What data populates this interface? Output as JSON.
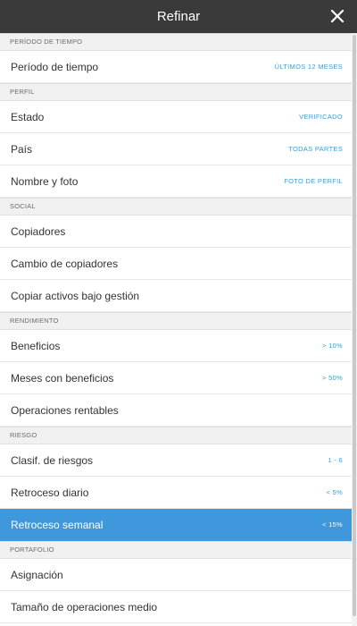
{
  "header": {
    "title": "Refinar"
  },
  "colors": {
    "accent": "#3b9cd6",
    "header_bg": "#3a3a3a",
    "selected_bg": "#3f98db"
  },
  "sections": [
    {
      "title": "PERÍODO DE TIEMPO",
      "rows": [
        {
          "label": "Período de tiempo",
          "value": "ÚLTIMOS 12 MESES"
        }
      ]
    },
    {
      "title": "PERFIL",
      "rows": [
        {
          "label": "Estado",
          "value": "VERIFICADO"
        },
        {
          "label": "País",
          "value": "TODAS PARTES"
        },
        {
          "label": "Nombre y foto",
          "value": "FOTO DE PERFIL"
        }
      ]
    },
    {
      "title": "SOCIAL",
      "rows": [
        {
          "label": "Copiadores",
          "value": ""
        },
        {
          "label": "Cambio de copiadores",
          "value": ""
        },
        {
          "label": "Copiar activos bajo gestión",
          "value": ""
        }
      ]
    },
    {
      "title": "RENDIMIENTO",
      "rows": [
        {
          "label": "Beneficios",
          "value": "> 10%"
        },
        {
          "label": "Meses con beneficios",
          "value": "> 50%"
        },
        {
          "label": "Operaciones rentables",
          "value": ""
        }
      ]
    },
    {
      "title": "RIESGO",
      "rows": [
        {
          "label": "Clasif. de riesgos",
          "value": "1 - 6"
        },
        {
          "label": "Retroceso diario",
          "value": "< 5%"
        },
        {
          "label": "Retroceso semanal",
          "value": "< 15%"
        }
      ]
    },
    {
      "title": "PORTAFOLIO",
      "rows": [
        {
          "label": "Asignación",
          "value": ""
        },
        {
          "label": "Tamaño de operaciones medio",
          "value": ""
        }
      ]
    }
  ]
}
